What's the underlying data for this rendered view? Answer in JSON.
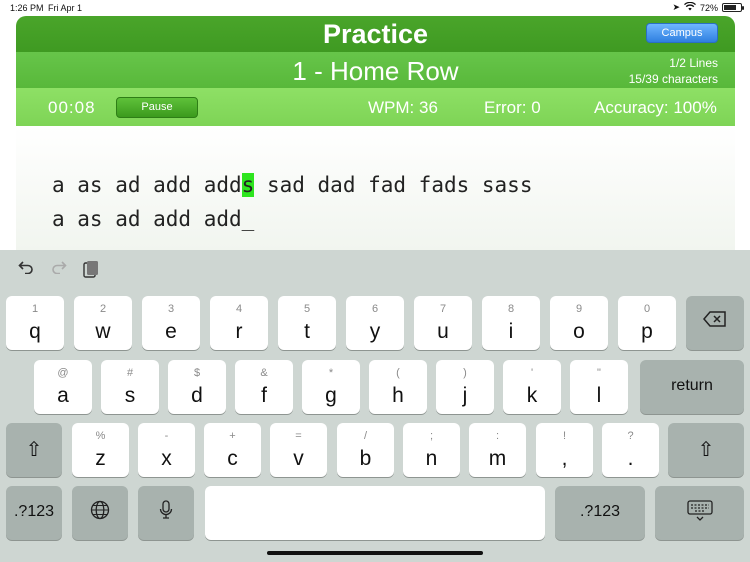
{
  "status": {
    "time": "1:26 PM",
    "date": "Fri Apr 1",
    "battery": "72%",
    "battery_level": 0.72
  },
  "app": {
    "title": "Practice",
    "campus_label": "Campus",
    "lesson_title": "1 - Home Row",
    "lines_progress": "1/2 Lines",
    "chars_progress": "15/39 characters",
    "timer": "00:08",
    "pause_label": "Pause",
    "wpm": "WPM: 36",
    "errors": "Error: 0",
    "accuracy": "Accuracy: 100%"
  },
  "typing": {
    "target_before": "a as ad add add",
    "target_current": "s",
    "target_after": " sad dad fad fads sass",
    "typed": "a as ad add add_"
  },
  "keyboard": {
    "toolbar": {
      "undo": "undo-icon",
      "redo": "redo-icon",
      "paste": "paste-icon"
    },
    "row1": [
      {
        "hint": "1",
        "key": "q"
      },
      {
        "hint": "2",
        "key": "w"
      },
      {
        "hint": "3",
        "key": "e"
      },
      {
        "hint": "4",
        "key": "r"
      },
      {
        "hint": "5",
        "key": "t"
      },
      {
        "hint": "6",
        "key": "y"
      },
      {
        "hint": "7",
        "key": "u"
      },
      {
        "hint": "8",
        "key": "i"
      },
      {
        "hint": "9",
        "key": "o"
      },
      {
        "hint": "0",
        "key": "p"
      }
    ],
    "row2": [
      {
        "hint": "@",
        "key": "a"
      },
      {
        "hint": "#",
        "key": "s"
      },
      {
        "hint": "$",
        "key": "d"
      },
      {
        "hint": "&",
        "key": "f"
      },
      {
        "hint": "*",
        "key": "g"
      },
      {
        "hint": "(",
        "key": "h"
      },
      {
        "hint": ")",
        "key": "j"
      },
      {
        "hint": "'",
        "key": "k"
      },
      {
        "hint": "\"",
        "key": "l"
      }
    ],
    "return_label": "return",
    "row3": [
      {
        "hint": "%",
        "key": "z"
      },
      {
        "hint": "-",
        "key": "x"
      },
      {
        "hint": "+",
        "key": "c"
      },
      {
        "hint": "=",
        "key": "v"
      },
      {
        "hint": "/",
        "key": "b"
      },
      {
        "hint": ";",
        "key": "n"
      },
      {
        "hint": ":",
        "key": "m"
      },
      {
        "hint": "!",
        "key": ","
      },
      {
        "hint": "?",
        "key": "."
      }
    ],
    "numbers_label": ".?123"
  }
}
